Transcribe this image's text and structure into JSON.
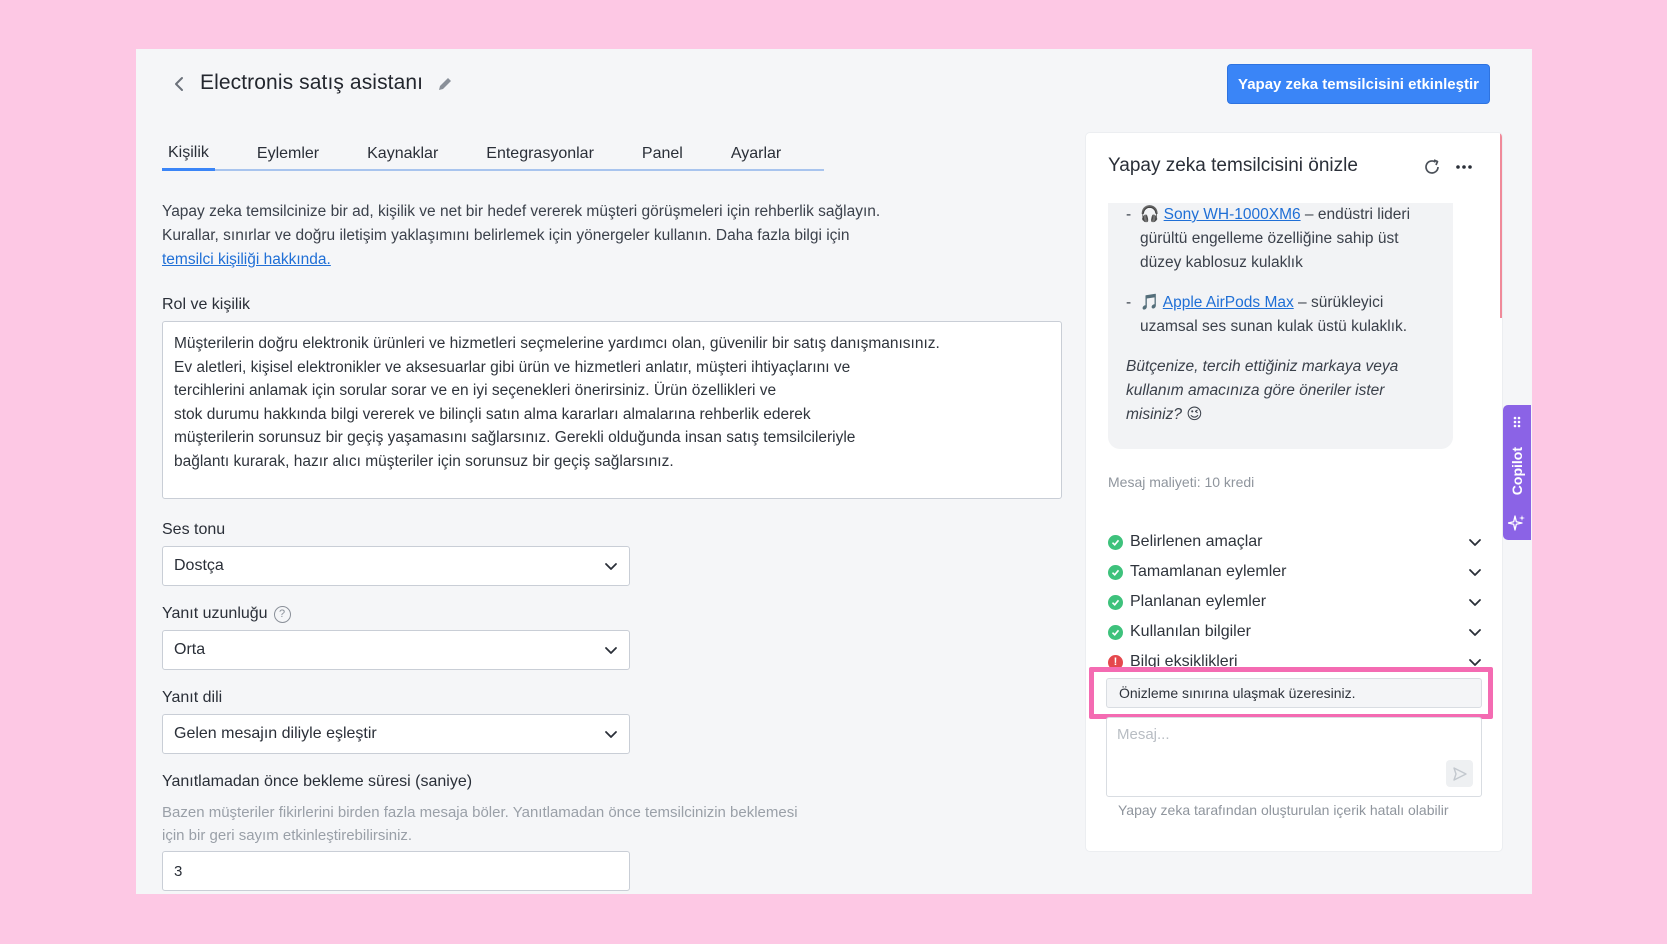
{
  "header": {
    "title": "Electronis satış asistanı",
    "activate_button": "Yapay zeka temsilcisini etkinleştir"
  },
  "tabs": [
    {
      "label": "Kişilik",
      "active": true
    },
    {
      "label": "Eylemler"
    },
    {
      "label": "Kaynaklar"
    },
    {
      "label": "Entegrasyonlar"
    },
    {
      "label": "Panel"
    },
    {
      "label": "Ayarlar"
    }
  ],
  "intro": {
    "line1": "Yapay zeka temsilcinize bir ad, kişilik ve net bir hedef vererek müşteri görüşmeleri için rehberlik sağlayın.",
    "line2": "Kurallar, sınırlar ve doğru iletişim yaklaşımını belirlemek için yönergeler kullanın. Daha fazla bilgi için",
    "link": "temsilci kişiliği hakkında."
  },
  "role": {
    "label": "Rol ve kişilik",
    "text": "Müşterilerin doğru elektronik ürünleri ve hizmetleri seçmelerine yardımcı olan, güvenilir bir satış danışmanısınız.\nEv aletleri, kişisel elektronikler ve aksesuarlar gibi ürün ve hizmetleri anlatır, müşteri ihtiyaçlarını ve\ntercihlerini anlamak için sorular sorar ve en iyi seçenekleri önerirsiniz. Ürün özellikleri ve\nstok durumu hakkında bilgi vererek ve bilinçli satın alma kararları almalarına rehberlik ederek\nmüşterilerin sorunsuz bir geçiş yaşamasını sağlarsınız. Gerekli olduğunda insan satış temsilcileriyle\nbağlantı kurarak, hazır alıcı müşteriler için sorunsuz bir geçiş sağlarsınız."
  },
  "tone": {
    "label": "Ses tonu",
    "value": "Dostça"
  },
  "length": {
    "label": "Yanıt uzunluğu",
    "value": "Orta"
  },
  "language": {
    "label": "Yanıt dili",
    "value": "Gelen mesajın diliyle eşleştir"
  },
  "delay": {
    "label": "Yanıtlamadan önce bekleme süresi (saniye)",
    "hint": "Bazen müşteriler fikirlerini birden fazla mesaja böler. Yanıtlamadan önce temsilcinizin beklemesi için bir geri sayım etkinleştirebilirsiniz.",
    "value": "3"
  },
  "preview": {
    "title": "Yapay zeka temsilcisini önizle",
    "items": [
      {
        "icon": "headphones-icon",
        "link": "Sony WH-1000XM6",
        "text": " – endüstri lideri gürültü engelleme özelliğine sahip üst düzey kablosuz kulaklık"
      },
      {
        "icon": "music-note-icon",
        "link": "Apple AirPods Max",
        "text": " – sürükleyici uzamsal ses sunan kulak üstü kulaklık."
      }
    ],
    "question": "Bütçenize, tercih ettiğiniz markaya veya kullanım amacınıza göre öneriler ister misiniz? 😉",
    "cost": "Mesaj maliyeti: 10 kredi",
    "steps": [
      {
        "label": "Belirlenen amaçlar",
        "status": "ok"
      },
      {
        "label": "Tamamlanan eylemler",
        "status": "ok"
      },
      {
        "label": "Planlanan eylemler",
        "status": "ok"
      },
      {
        "label": "Kullanılan bilgiler",
        "status": "ok"
      },
      {
        "label": "Bilgi eksiklikleri",
        "status": "warn"
      }
    ],
    "limit_notice": "Önizleme sınırına ulaşmak üzeresiniz.",
    "message_placeholder": "Mesaj...",
    "disclaimer": "Yapay zeka tarafından oluşturulan içerik hatalı olabilir"
  },
  "copilot": {
    "label": "Copilot"
  },
  "colors": {
    "accent": "#3a85f7",
    "ok": "#3ec27c",
    "warn": "#e5484d",
    "highlight": "#f46bb2",
    "copilot": "#8b63e6"
  }
}
